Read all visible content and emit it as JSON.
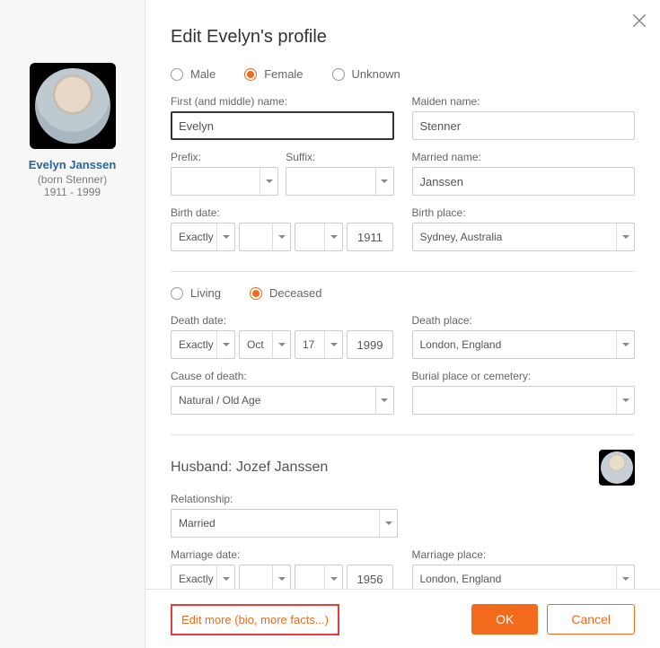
{
  "sidebar": {
    "name": "Evelyn Janssen",
    "born": "(born Stenner)",
    "years": "1911 - 1999"
  },
  "header": {
    "title": "Edit Evelyn's profile"
  },
  "gender": {
    "options": [
      "Male",
      "Female",
      "Unknown"
    ],
    "selected": "Female"
  },
  "labels": {
    "first_name": "First (and middle) name:",
    "maiden_name": "Maiden name:",
    "prefix": "Prefix:",
    "suffix": "Suffix:",
    "married_name": "Married name:",
    "birth_date": "Birth date:",
    "birth_place": "Birth place:",
    "death_date": "Death date:",
    "death_place": "Death place:",
    "cause_of_death": "Cause of death:",
    "burial_place": "Burial place or cemetery:",
    "relationship": "Relationship:",
    "marriage_date": "Marriage date:",
    "marriage_place": "Marriage place:"
  },
  "fields": {
    "first_name": "Evelyn",
    "maiden_name": "Stenner",
    "prefix": "",
    "suffix": "",
    "married_name": "Janssen",
    "birth_precision": "Exactly",
    "birth_month": "",
    "birth_day": "",
    "birth_year": "1911",
    "birth_place": "Sydney, Australia",
    "death_precision": "Exactly",
    "death_month": "Oct",
    "death_day": "17",
    "death_year": "1999",
    "death_place": "London, England",
    "cause_of_death": "Natural / Old Age",
    "burial_place": "",
    "relationship": "Married",
    "marriage_precision": "Exactly",
    "marriage_month": "",
    "marriage_day": "",
    "marriage_year": "1956",
    "marriage_place": "London, England"
  },
  "living_status": {
    "options": [
      "Living",
      "Deceased"
    ],
    "selected": "Deceased"
  },
  "spouse": {
    "label": "Husband:",
    "name": "Jozef Janssen"
  },
  "footer": {
    "edit_more": "Edit more (bio, more facts...)",
    "ok": "OK",
    "cancel": "Cancel"
  }
}
